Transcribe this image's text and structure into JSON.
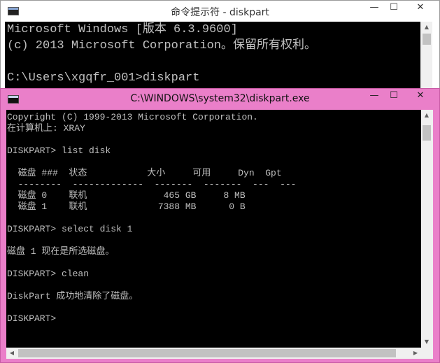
{
  "window_back": {
    "title": "命令提示符 - diskpart",
    "controls": {
      "minimize": "—",
      "maximize": "☐",
      "close": "✕"
    },
    "lines": [
      "Microsoft Windows [版本 6.3.9600]",
      "(c) 2013 Microsoft Corporation。保留所有权利。",
      "",
      "C:\\Users\\xgqfr_001>diskpart"
    ]
  },
  "window_front": {
    "title": "C:\\WINDOWS\\system32\\diskpart.exe",
    "controls": {
      "minimize": "—",
      "maximize": "☐",
      "close": "✕"
    },
    "lines": [
      "Copyright (C) 1999-2013 Microsoft Corporation.",
      "在计算机上: XRAY",
      "",
      "DISKPART> list disk",
      "",
      "  磁盘 ###  状态           大小     可用     Dyn  Gpt",
      "  --------  -------------  -------  -------  ---  ---",
      "  磁盘 0    联机              465 GB     8 MB",
      "  磁盘 1    联机             7388 MB      0 B",
      "",
      "DISKPART> select disk 1",
      "",
      "磁盘 1 现在是所选磁盘。",
      "",
      "DISKPART> clean",
      "",
      "DiskPart 成功地清除了磁盘。",
      "",
      "DISKPART> "
    ]
  }
}
